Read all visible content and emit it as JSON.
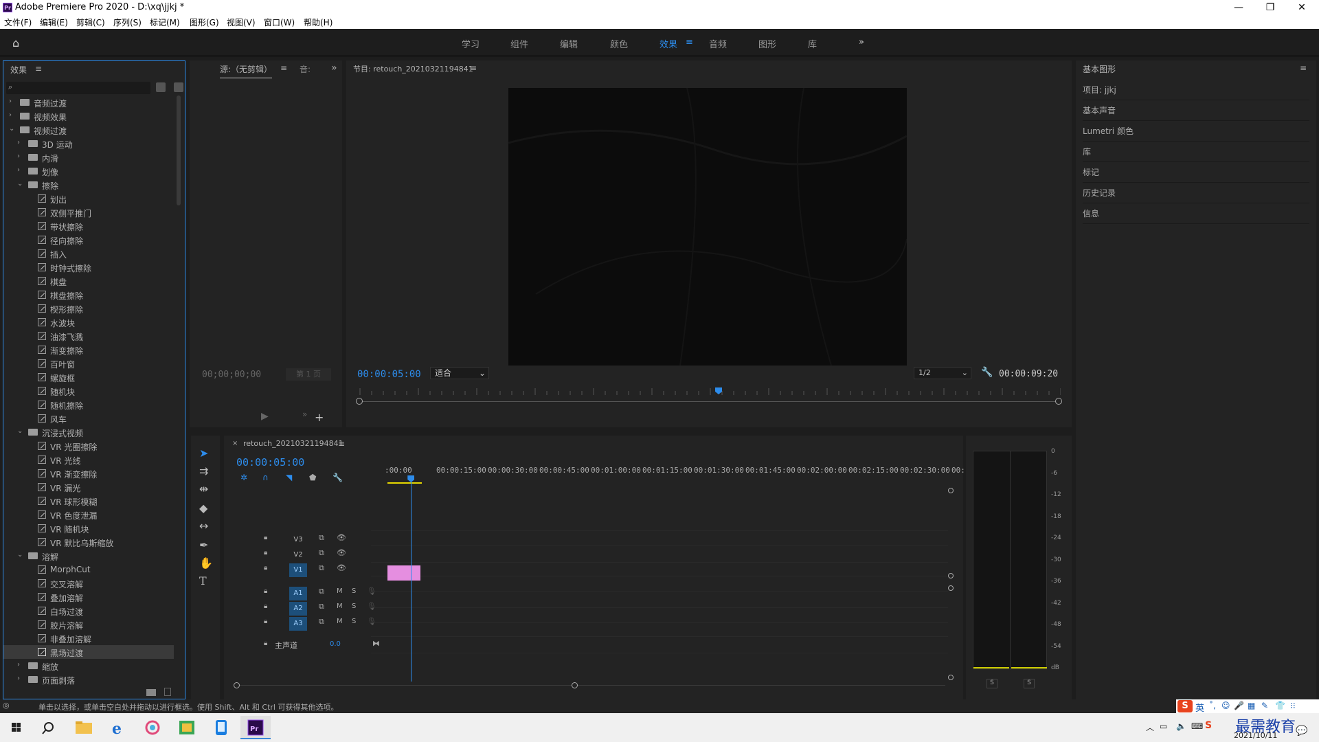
{
  "window": {
    "title": "Adobe Premiere Pro 2020 - D:\\xq\\jjkj *",
    "app_icon": "Pr",
    "min_icon": "minimize-icon",
    "max_icon": "maximize-icon",
    "close_icon": "close-icon"
  },
  "menu": [
    "文件(F)",
    "编辑(E)",
    "剪辑(C)",
    "序列(S)",
    "标记(M)",
    "图形(G)",
    "视图(V)",
    "窗口(W)",
    "帮助(H)"
  ],
  "workspaces": [
    {
      "label": "学习",
      "active": false
    },
    {
      "label": "组件",
      "active": false
    },
    {
      "label": "编辑",
      "active": false
    },
    {
      "label": "颜色",
      "active": false
    },
    {
      "label": "效果",
      "active": true
    },
    {
      "label": "音频",
      "active": false
    },
    {
      "label": "图形",
      "active": false
    },
    {
      "label": "库",
      "active": false
    }
  ],
  "workspace_more": "»",
  "effects_panel": {
    "title": "效果",
    "search_placeholder": "",
    "tree": [
      {
        "label": "音频过渡",
        "type": "folder",
        "level": 0,
        "expanded": false
      },
      {
        "label": "视频效果",
        "type": "folder",
        "level": 0,
        "expanded": false
      },
      {
        "label": "视频过渡",
        "type": "folder",
        "level": 0,
        "expanded": true
      },
      {
        "label": "3D 运动",
        "type": "folder",
        "level": 1,
        "expanded": false
      },
      {
        "label": "内滑",
        "type": "folder",
        "level": 1,
        "expanded": false
      },
      {
        "label": "划像",
        "type": "folder",
        "level": 1,
        "expanded": false
      },
      {
        "label": "擦除",
        "type": "folder",
        "level": 1,
        "expanded": true
      },
      {
        "label": "划出",
        "type": "fx",
        "level": 2
      },
      {
        "label": "双侧平推门",
        "type": "fx",
        "level": 2
      },
      {
        "label": "带状擦除",
        "type": "fx",
        "level": 2
      },
      {
        "label": "径向擦除",
        "type": "fx",
        "level": 2
      },
      {
        "label": "插入",
        "type": "fx",
        "level": 2
      },
      {
        "label": "时钟式擦除",
        "type": "fx",
        "level": 2
      },
      {
        "label": "棋盘",
        "type": "fx",
        "level": 2
      },
      {
        "label": "棋盘擦除",
        "type": "fx",
        "level": 2
      },
      {
        "label": "楔形擦除",
        "type": "fx",
        "level": 2
      },
      {
        "label": "水波块",
        "type": "fx",
        "level": 2
      },
      {
        "label": "油漆飞溅",
        "type": "fx",
        "level": 2
      },
      {
        "label": "渐变擦除",
        "type": "fx",
        "level": 2
      },
      {
        "label": "百叶窗",
        "type": "fx",
        "level": 2
      },
      {
        "label": "螺旋框",
        "type": "fx",
        "level": 2
      },
      {
        "label": "随机块",
        "type": "fx",
        "level": 2
      },
      {
        "label": "随机擦除",
        "type": "fx",
        "level": 2
      },
      {
        "label": "风车",
        "type": "fx",
        "level": 2
      },
      {
        "label": "沉浸式视频",
        "type": "folder",
        "level": 1,
        "expanded": true
      },
      {
        "label": "VR 光圈擦除",
        "type": "fx",
        "level": 2
      },
      {
        "label": "VR 光线",
        "type": "fx",
        "level": 2
      },
      {
        "label": "VR 渐变擦除",
        "type": "fx",
        "level": 2
      },
      {
        "label": "VR 漏光",
        "type": "fx",
        "level": 2
      },
      {
        "label": "VR 球形模糊",
        "type": "fx",
        "level": 2
      },
      {
        "label": "VR 色度泄漏",
        "type": "fx",
        "level": 2
      },
      {
        "label": "VR 随机块",
        "type": "fx",
        "level": 2
      },
      {
        "label": "VR 默比乌斯缩放",
        "type": "fx",
        "level": 2
      },
      {
        "label": "溶解",
        "type": "folder",
        "level": 1,
        "expanded": true
      },
      {
        "label": "MorphCut",
        "type": "fx",
        "level": 2
      },
      {
        "label": "交叉溶解",
        "type": "fx",
        "level": 2
      },
      {
        "label": "叠加溶解",
        "type": "fx",
        "level": 2
      },
      {
        "label": "白场过渡",
        "type": "fx",
        "level": 2
      },
      {
        "label": "胶片溶解",
        "type": "fx",
        "level": 2
      },
      {
        "label": "非叠加溶解",
        "type": "fx",
        "level": 2
      },
      {
        "label": "黑场过渡",
        "type": "fx",
        "level": 2,
        "selected": true
      },
      {
        "label": "缩放",
        "type": "folder",
        "level": 1,
        "expanded": false
      },
      {
        "label": "页面剥落",
        "type": "folder",
        "level": 1,
        "expanded": false
      }
    ]
  },
  "source_panel": {
    "tab1": "源:（无剪辑）",
    "tab2": "音:",
    "timecode": "00;00;00;00",
    "page": "第 1 页"
  },
  "program_panel": {
    "title": "节目: retouch_20210321194841",
    "timecode": "00:00:05:00",
    "fit": "适合",
    "resolution": "1/2",
    "duration": "00:00:09:20"
  },
  "timeline": {
    "tab": "retouch_20210321194841",
    "timecode": "00:00:05:00",
    "ruler": [
      ":00:00",
      "00:00:15:00",
      "00:00:30:00",
      "00:00:45:00",
      "00:01:00:00",
      "00:01:15:00",
      "00:01:30:00",
      "00:01:45:00",
      "00:02:00:00",
      "00:02:15:00",
      "00:02:30:00",
      "00:"
    ],
    "video_tracks": [
      "V3",
      "V2",
      "V1"
    ],
    "audio_tracks": [
      "A1",
      "A2",
      "A3"
    ],
    "master_label": "主声道",
    "master_value": "0.0",
    "m_label": "M",
    "s_label": "S",
    "playhead_progress": 0.042,
    "clip_color": "#e58ee0"
  },
  "meters": {
    "scale": [
      "0",
      "-6",
      "-12",
      "-18",
      "-24",
      "-30",
      "-36",
      "-42",
      "-48",
      "-54",
      "dB"
    ],
    "solo_left": "S",
    "solo_right": "S"
  },
  "essential_panel": {
    "title": "基本图形",
    "items": [
      "项目: jjkj",
      "基本声音",
      "Lumetri 颜色",
      "库",
      "标记",
      "历史记录",
      "信息"
    ]
  },
  "status": {
    "text": "单击以选择，或单击空白处并拖动以进行框选。使用 Shift、Alt 和 Ctrl 可获得其他选项。"
  },
  "tray": {
    "ime": "英",
    "date": "2021/10/11",
    "watermark": "最需教育"
  },
  "colors": {
    "accent": "#2d8ceb",
    "panel": "#232323",
    "bg": "#1d1d1d"
  }
}
